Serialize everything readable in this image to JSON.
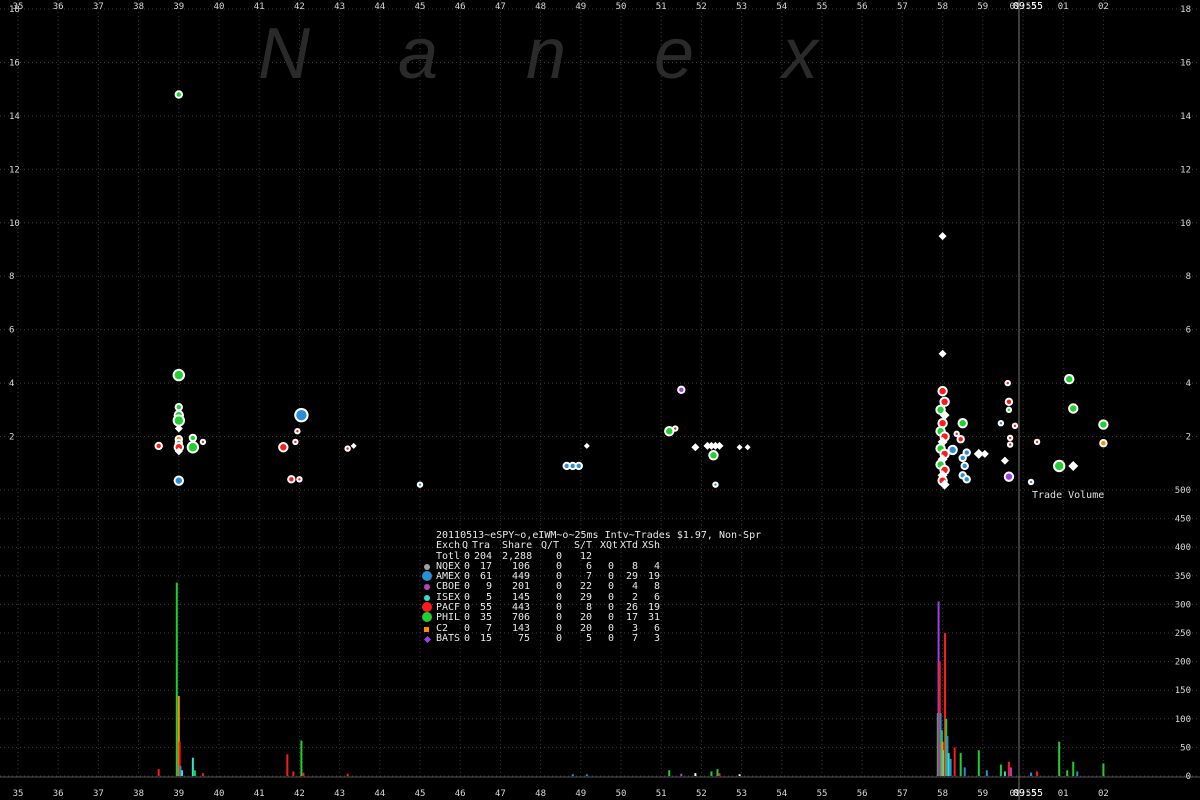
{
  "chart_data": {
    "type": "scatter",
    "watermark": "N a n e x",
    "title": "20110513~eSPY~o,eIWM~o~25ms Intv~Trades $1.97, Non-Spr",
    "x_ticks": [
      "35",
      "36",
      "37",
      "38",
      "39",
      "40",
      "41",
      "42",
      "43",
      "44",
      "45",
      "46",
      "47",
      "48",
      "49",
      "50",
      "51",
      "52",
      "53",
      "54",
      "55",
      "56",
      "57",
      "58",
      "59",
      "09:55",
      "01",
      "02"
    ],
    "price_y_ticks": [
      2,
      4,
      6,
      8,
      10,
      12,
      14,
      16,
      18
    ],
    "price_ylim": [
      0,
      18
    ],
    "volume_y_ticks": [
      0,
      50,
      100,
      150,
      200,
      250,
      300,
      350,
      400,
      450,
      500
    ],
    "volume_ylim": [
      0,
      500
    ],
    "volume_label": "Trade Volume",
    "cursor_label": "09:55",
    "grid": true,
    "colors": {
      "NQEX": "#a0a0a0",
      "AMEX": "#2a8fd6",
      "CBOE": "#c040c0",
      "ISEX": "#30e0d0",
      "PACF": "#ff1a1a",
      "PHIL": "#20d030",
      "C2": "#ff8c00",
      "BATS": "#a040e0",
      "white": "#ffffff"
    },
    "legend": {
      "header": [
        "Exch",
        "Q",
        "Tra",
        "Share",
        "Q/T",
        "S/T",
        "XQt",
        "XTd",
        "XSh"
      ],
      "total": [
        "Totl",
        "0",
        "204",
        "2,288",
        "0",
        "12",
        "",
        "",
        ""
      ],
      "rows": [
        {
          "name": "NQEX",
          "marker": "NQEX",
          "cells": [
            "0",
            "17",
            "106",
            "0",
            "6",
            "0",
            "8",
            "4"
          ]
        },
        {
          "name": "AMEX",
          "marker": "AMEX",
          "cells": [
            "0",
            "61",
            "449",
            "0",
            "7",
            "0",
            "29",
            "19"
          ]
        },
        {
          "name": "CBOE",
          "marker": "CBOE",
          "cells": [
            "0",
            "9",
            "201",
            "0",
            "22",
            "0",
            "4",
            "8"
          ]
        },
        {
          "name": "ISEX",
          "marker": "ISEX",
          "cells": [
            "0",
            "5",
            "145",
            "0",
            "29",
            "0",
            "2",
            "6"
          ]
        },
        {
          "name": "PACF",
          "marker": "PACF",
          "cells": [
            "0",
            "55",
            "443",
            "0",
            "8",
            "0",
            "26",
            "19"
          ]
        },
        {
          "name": "PHIL",
          "marker": "PHIL",
          "cells": [
            "0",
            "35",
            "706",
            "0",
            "20",
            "0",
            "17",
            "31"
          ]
        },
        {
          "name": "C2",
          "marker": "C2",
          "cells": [
            "0",
            "7",
            "143",
            "0",
            "20",
            "0",
            "3",
            "6"
          ]
        },
        {
          "name": "BATS",
          "marker": "BATS",
          "cells": [
            "0",
            "15",
            "75",
            "0",
            "5",
            "0",
            "7",
            "3"
          ]
        }
      ]
    },
    "price_points": [
      {
        "x": 38.5,
        "y": 1.65,
        "c": "PACF",
        "s": 3
      },
      {
        "x": 39.0,
        "y": 14.8,
        "c": "PHIL",
        "s": 3
      },
      {
        "x": 39.0,
        "y": 4.3,
        "c": "PHIL",
        "s": 5
      },
      {
        "x": 39.0,
        "y": 3.1,
        "c": "PHIL",
        "s": 3
      },
      {
        "x": 39.0,
        "y": 2.8,
        "c": "PHIL",
        "s": 4
      },
      {
        "x": 39.0,
        "y": 2.6,
        "c": "PHIL",
        "s": 5
      },
      {
        "x": 39.0,
        "y": 2.3,
        "c": "white",
        "s": 3
      },
      {
        "x": 39.0,
        "y": 1.9,
        "c": "C2",
        "s": 3
      },
      {
        "x": 39.0,
        "y": 1.75,
        "c": "AMEX",
        "s": 3
      },
      {
        "x": 39.0,
        "y": 1.6,
        "c": "PACF",
        "s": 4
      },
      {
        "x": 39.0,
        "y": 1.45,
        "c": "white",
        "s": 3
      },
      {
        "x": 39.0,
        "y": 0.35,
        "c": "AMEX",
        "s": 4
      },
      {
        "x": 39.35,
        "y": 1.95,
        "c": "PHIL",
        "s": 3
      },
      {
        "x": 39.35,
        "y": 1.6,
        "c": "PHIL",
        "s": 5
      },
      {
        "x": 39.6,
        "y": 1.8,
        "c": "PACF",
        "s": 2
      },
      {
        "x": 41.6,
        "y": 1.6,
        "c": "PACF",
        "s": 4
      },
      {
        "x": 41.8,
        "y": 0.4,
        "c": "PACF",
        "s": 3
      },
      {
        "x": 42.0,
        "y": 0.4,
        "c": "PACF",
        "s": 2
      },
      {
        "x": 41.9,
        "y": 1.8,
        "c": "PACF",
        "s": 2
      },
      {
        "x": 41.95,
        "y": 2.2,
        "c": "PACF",
        "s": 2
      },
      {
        "x": 42.05,
        "y": 2.8,
        "c": "AMEX",
        "s": 6
      },
      {
        "x": 43.2,
        "y": 1.55,
        "c": "PACF",
        "s": 2
      },
      {
        "x": 43.35,
        "y": 1.65,
        "c": "white",
        "s": 2
      },
      {
        "x": 45.0,
        "y": 0.2,
        "c": "AMEX",
        "s": 2
      },
      {
        "x": 48.65,
        "y": 0.9,
        "c": "AMEX",
        "s": 3
      },
      {
        "x": 48.8,
        "y": 0.9,
        "c": "AMEX",
        "s": 3
      },
      {
        "x": 48.95,
        "y": 0.9,
        "c": "AMEX",
        "s": 3
      },
      {
        "x": 49.15,
        "y": 1.65,
        "c": "white",
        "s": 2
      },
      {
        "x": 51.2,
        "y": 2.2,
        "c": "PHIL",
        "s": 4
      },
      {
        "x": 51.35,
        "y": 2.3,
        "c": "PACF",
        "s": 2
      },
      {
        "x": 51.5,
        "y": 3.75,
        "c": "BATS",
        "s": 3
      },
      {
        "x": 51.85,
        "y": 1.6,
        "c": "white",
        "s": 3
      },
      {
        "x": 52.15,
        "y": 1.65,
        "c": "white",
        "s": 3
      },
      {
        "x": 52.25,
        "y": 1.65,
        "c": "white",
        "s": 3
      },
      {
        "x": 52.35,
        "y": 1.65,
        "c": "white",
        "s": 3
      },
      {
        "x": 52.45,
        "y": 1.65,
        "c": "white",
        "s": 3
      },
      {
        "x": 52.3,
        "y": 1.3,
        "c": "PHIL",
        "s": 4
      },
      {
        "x": 52.35,
        "y": 0.2,
        "c": "AMEX",
        "s": 2
      },
      {
        "x": 52.95,
        "y": 1.6,
        "c": "white",
        "s": 2
      },
      {
        "x": 53.15,
        "y": 1.6,
        "c": "white",
        "s": 2
      },
      {
        "x": 58.0,
        "y": 9.5,
        "c": "white",
        "s": 3
      },
      {
        "x": 58.0,
        "y": 5.1,
        "c": "white",
        "s": 3
      },
      {
        "x": 58.0,
        "y": 3.7,
        "c": "PACF",
        "s": 4
      },
      {
        "x": 58.05,
        "y": 3.3,
        "c": "PACF",
        "s": 4
      },
      {
        "x": 57.95,
        "y": 3.0,
        "c": "PHIL",
        "s": 4
      },
      {
        "x": 58.05,
        "y": 2.8,
        "c": "white",
        "s": 4
      },
      {
        "x": 58.0,
        "y": 2.5,
        "c": "PACF",
        "s": 4
      },
      {
        "x": 57.95,
        "y": 2.2,
        "c": "PHIL",
        "s": 4
      },
      {
        "x": 58.05,
        "y": 2.0,
        "c": "PACF",
        "s": 4
      },
      {
        "x": 58.0,
        "y": 1.8,
        "c": "white",
        "s": 4
      },
      {
        "x": 57.95,
        "y": 1.55,
        "c": "PHIL",
        "s": 4
      },
      {
        "x": 58.05,
        "y": 1.35,
        "c": "PACF",
        "s": 4
      },
      {
        "x": 58.0,
        "y": 1.15,
        "c": "white",
        "s": 4
      },
      {
        "x": 57.95,
        "y": 0.95,
        "c": "PHIL",
        "s": 4
      },
      {
        "x": 58.05,
        "y": 0.75,
        "c": "PACF",
        "s": 4
      },
      {
        "x": 58.0,
        "y": 0.55,
        "c": "white",
        "s": 4
      },
      {
        "x": 58.0,
        "y": 0.35,
        "c": "PACF",
        "s": 4
      },
      {
        "x": 58.05,
        "y": 0.2,
        "c": "white",
        "s": 4
      },
      {
        "x": 58.25,
        "y": 1.5,
        "c": "AMEX",
        "s": 4
      },
      {
        "x": 58.35,
        "y": 2.1,
        "c": "PACF",
        "s": 2
      },
      {
        "x": 58.5,
        "y": 2.5,
        "c": "PHIL",
        "s": 4
      },
      {
        "x": 58.45,
        "y": 1.9,
        "c": "PACF",
        "s": 3
      },
      {
        "x": 58.5,
        "y": 1.2,
        "c": "AMEX",
        "s": 3
      },
      {
        "x": 58.55,
        "y": 0.9,
        "c": "AMEX",
        "s": 3
      },
      {
        "x": 58.6,
        "y": 1.4,
        "c": "AMEX",
        "s": 3
      },
      {
        "x": 58.5,
        "y": 0.55,
        "c": "AMEX",
        "s": 3
      },
      {
        "x": 58.6,
        "y": 0.4,
        "c": "AMEX",
        "s": 3
      },
      {
        "x": 58.9,
        "y": 1.35,
        "c": "white",
        "s": 4
      },
      {
        "x": 59.05,
        "y": 1.35,
        "c": "white",
        "s": 3
      },
      {
        "x": 59.45,
        "y": 2.5,
        "c": "AMEX",
        "s": 2
      },
      {
        "x": 59.55,
        "y": 1.1,
        "c": "white",
        "s": 3
      },
      {
        "x": 59.65,
        "y": 0.5,
        "c": "BATS",
        "s": 4
      },
      {
        "x": 59.65,
        "y": 3.3,
        "c": "PACF",
        "s": 3
      },
      {
        "x": 59.62,
        "y": 4.0,
        "c": "PACF",
        "s": 2
      },
      {
        "x": 59.65,
        "y": 3.0,
        "c": "PHIL",
        "s": 2
      },
      {
        "x": 59.68,
        "y": 1.95,
        "c": "PACF",
        "s": 2
      },
      {
        "x": 59.68,
        "y": 1.7,
        "c": "PACF",
        "s": 2
      },
      {
        "x": 59.8,
        "y": 2.4,
        "c": "PACF",
        "s": 2
      },
      {
        "x": 60.2,
        "y": 0.3,
        "c": "AMEX",
        "s": 2
      },
      {
        "x": 60.35,
        "y": 1.8,
        "c": "PACF",
        "s": 2
      },
      {
        "x": 60.9,
        "y": 0.9,
        "c": "PHIL",
        "s": 5
      },
      {
        "x": 61.15,
        "y": 4.15,
        "c": "PHIL",
        "s": 4
      },
      {
        "x": 61.25,
        "y": 0.9,
        "c": "white",
        "s": 4
      },
      {
        "x": 61.25,
        "y": 3.05,
        "c": "PHIL",
        "s": 4
      },
      {
        "x": 62.0,
        "y": 2.45,
        "c": "PHIL",
        "s": 4
      },
      {
        "x": 62.0,
        "y": 1.75,
        "c": "C2",
        "s": 3
      }
    ],
    "volume_bars": [
      {
        "x": 38.5,
        "v": 12,
        "c": "PACF"
      },
      {
        "x": 38.95,
        "v": 338,
        "c": "PHIL"
      },
      {
        "x": 39.0,
        "v": 140,
        "c": "C2"
      },
      {
        "x": 39.02,
        "v": 60,
        "c": "PACF"
      },
      {
        "x": 39.04,
        "v": 18,
        "c": "AMEX"
      },
      {
        "x": 39.08,
        "v": 10,
        "c": "ISEX"
      },
      {
        "x": 39.35,
        "v": 32,
        "c": "ISEX"
      },
      {
        "x": 39.4,
        "v": 10,
        "c": "PHIL"
      },
      {
        "x": 39.6,
        "v": 5,
        "c": "PACF"
      },
      {
        "x": 41.7,
        "v": 38,
        "c": "PACF"
      },
      {
        "x": 41.85,
        "v": 8,
        "c": "PACF"
      },
      {
        "x": 42.05,
        "v": 62,
        "c": "PHIL"
      },
      {
        "x": 42.1,
        "v": 6,
        "c": "PACF"
      },
      {
        "x": 43.2,
        "v": 4,
        "c": "PACF"
      },
      {
        "x": 48.8,
        "v": 3,
        "c": "AMEX"
      },
      {
        "x": 49.15,
        "v": 3,
        "c": "AMEX"
      },
      {
        "x": 51.2,
        "v": 10,
        "c": "PHIL"
      },
      {
        "x": 51.5,
        "v": 4,
        "c": "BATS"
      },
      {
        "x": 51.85,
        "v": 5,
        "c": "white"
      },
      {
        "x": 52.25,
        "v": 8,
        "c": "PHIL"
      },
      {
        "x": 52.4,
        "v": 12,
        "c": "PHIL"
      },
      {
        "x": 52.45,
        "v": 5,
        "c": "PACF"
      },
      {
        "x": 52.95,
        "v": 3,
        "c": "white"
      },
      {
        "x": 57.88,
        "v": 110,
        "c": "PHIL"
      },
      {
        "x": 57.9,
        "v": 305,
        "c": "BATS"
      },
      {
        "x": 57.93,
        "v": 200,
        "c": "PACF"
      },
      {
        "x": 57.95,
        "v": 110,
        "c": "AMEX"
      },
      {
        "x": 57.98,
        "v": 80,
        "c": "PHIL"
      },
      {
        "x": 58.0,
        "v": 60,
        "c": "C2"
      },
      {
        "x": 58.03,
        "v": 45,
        "c": "ISEX"
      },
      {
        "x": 58.06,
        "v": 250,
        "c": "PACF"
      },
      {
        "x": 58.09,
        "v": 100,
        "c": "PHIL"
      },
      {
        "x": 58.12,
        "v": 70,
        "c": "AMEX"
      },
      {
        "x": 58.15,
        "v": 40,
        "c": "ISEX"
      },
      {
        "x": 58.2,
        "v": 30,
        "c": "AMEX"
      },
      {
        "x": 58.3,
        "v": 50,
        "c": "PACF"
      },
      {
        "x": 58.45,
        "v": 40,
        "c": "PHIL"
      },
      {
        "x": 58.55,
        "v": 15,
        "c": "AMEX"
      },
      {
        "x": 58.9,
        "v": 45,
        "c": "PHIL"
      },
      {
        "x": 59.1,
        "v": 10,
        "c": "AMEX"
      },
      {
        "x": 59.45,
        "v": 20,
        "c": "PHIL"
      },
      {
        "x": 59.55,
        "v": 8,
        "c": "ISEX"
      },
      {
        "x": 59.65,
        "v": 25,
        "c": "PACF"
      },
      {
        "x": 59.7,
        "v": 15,
        "c": "BATS"
      },
      {
        "x": 60.2,
        "v": 6,
        "c": "AMEX"
      },
      {
        "x": 60.35,
        "v": 8,
        "c": "PACF"
      },
      {
        "x": 60.9,
        "v": 60,
        "c": "PHIL"
      },
      {
        "x": 61.1,
        "v": 10,
        "c": "PHIL"
      },
      {
        "x": 61.25,
        "v": 25,
        "c": "PHIL"
      },
      {
        "x": 61.35,
        "v": 8,
        "c": "AMEX"
      },
      {
        "x": 62.0,
        "v": 22,
        "c": "PHIL"
      }
    ]
  }
}
